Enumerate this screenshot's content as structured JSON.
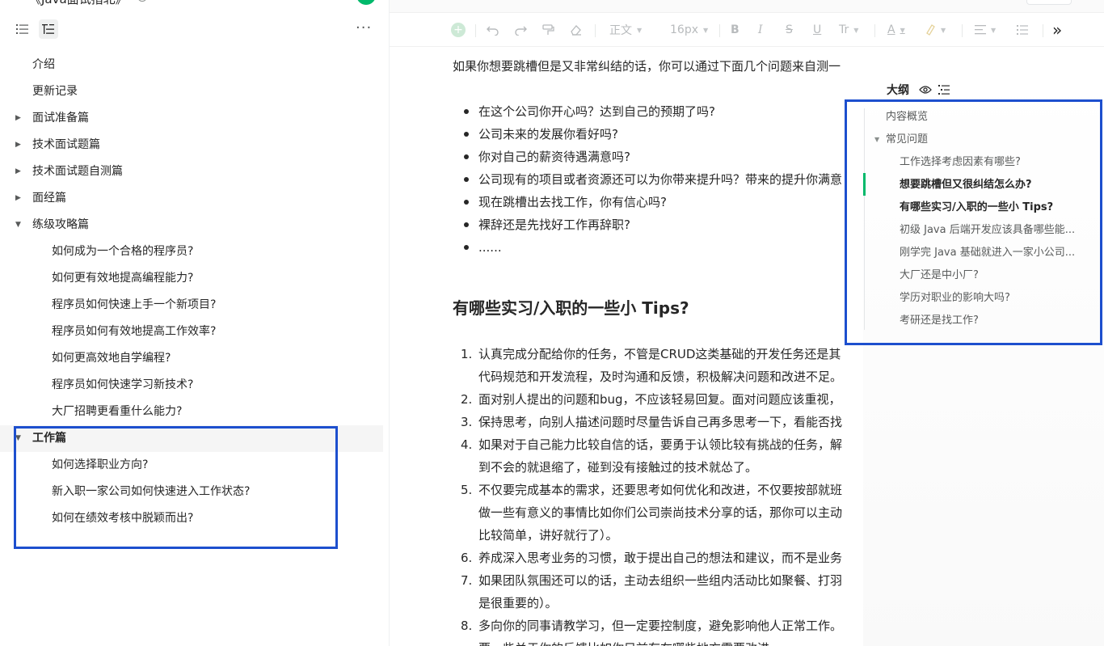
{
  "sidebar": {
    "title": "《Java面试指北》",
    "nav": [
      {
        "label": "介绍",
        "level": 0,
        "caret": ""
      },
      {
        "label": "更新记录",
        "level": 0,
        "caret": ""
      },
      {
        "label": "面试准备篇",
        "level": 0,
        "caret": "▶"
      },
      {
        "label": "技术面试题篇",
        "level": 0,
        "caret": "▶"
      },
      {
        "label": "技术面试题自测篇",
        "level": 0,
        "caret": "▶"
      },
      {
        "label": "面经篇",
        "level": 0,
        "caret": "▶"
      },
      {
        "label": "练级攻略篇",
        "level": 0,
        "caret": "▼"
      },
      {
        "label": "如何成为一个合格的程序员?",
        "level": 1,
        "caret": ""
      },
      {
        "label": "如何更有效地提高编程能力?",
        "level": 1,
        "caret": ""
      },
      {
        "label": "程序员如何快速上手一个新项目?",
        "level": 1,
        "caret": ""
      },
      {
        "label": "程序员如何有效地提高工作效率?",
        "level": 1,
        "caret": ""
      },
      {
        "label": "如何更高效地自学编程?",
        "level": 1,
        "caret": ""
      },
      {
        "label": "程序员如何快速学习新技术?",
        "level": 1,
        "caret": ""
      },
      {
        "label": "大厂招聘更看重什么能力?",
        "level": 1,
        "caret": ""
      },
      {
        "label": "工作篇",
        "level": 0,
        "caret": "▼",
        "selected": true
      },
      {
        "label": "如何选择职业方向?",
        "level": 1,
        "caret": ""
      },
      {
        "label": "新入职一家公司如何快速进入工作状态?",
        "level": 1,
        "caret": ""
      },
      {
        "label": "如何在绩效考核中脱颖而出?",
        "level": 1,
        "caret": ""
      }
    ],
    "more_label": "···",
    "highlight_color": "#1d4fce"
  },
  "toolbar": {
    "style_label": "正文",
    "size_label": "16px"
  },
  "doc": {
    "intro": "如果你想要跳槽但是又非常纠结的话，你可以通过下面几个问题来自测一",
    "bullets": [
      "在这个公司你开心吗？达到自己的预期了吗?",
      "公司未来的发展你看好吗?",
      "你对自己的薪资待遇满意吗?",
      "公司现有的项目或者资源还可以为你带来提升吗？带来的提升你满意",
      "现在跳槽出去找工作，你有信心吗?",
      "裸辞还是先找好工作再辞职?",
      "......"
    ],
    "heading": "有哪些实习/入职的一些小 Tips?",
    "numbered": [
      {
        "n": "1.",
        "lines": [
          "认真完成分配给你的任务，不管是CRUD这类基础的开发任务还是其",
          "代码规范和开发流程，及时沟通和反馈，积极解决问题和改进不足。"
        ]
      },
      {
        "n": "2.",
        "lines": [
          "面对别人提出的问题和bug，不应该轻易回复。面对问题应该重视，"
        ]
      },
      {
        "n": "3.",
        "lines": [
          "保持思考，向别人描述问题时尽量告诉自己再多思考一下，看能否找"
        ]
      },
      {
        "n": "4.",
        "lines": [
          "如果对于自己能力比较自信的话，要勇于认领比较有挑战的任务，解",
          "到不会的就退缩了，碰到没有接触过的技术就怂了。"
        ]
      },
      {
        "n": "5.",
        "lines": [
          "不仅要完成基本的需求，还要思考如何优化和改进，不仅要按部就班",
          "做一些有意义的事情比如你们公司崇尚技术分享的话，那你可以主动",
          "比较简单，讲好就行了）。"
        ]
      },
      {
        "n": "6.",
        "lines": [
          "养成深入思考业务的习惯，敢于提出自己的想法和建议，而不是业务"
        ]
      },
      {
        "n": "7.",
        "lines": [
          "如果团队氛围还可以的话，主动去组织一些组内活动比如聚餐、打羽",
          "是很重要的）。"
        ]
      },
      {
        "n": "8.",
        "lines": [
          "多向你的同事请教学习，但一定要控制度，避免影响他人正常工作。",
          "要一些关于你的反馈比如你目前存在哪些地方需要改进"
        ]
      }
    ]
  },
  "outline": {
    "title": "大纲",
    "items": [
      {
        "label": "内容概览",
        "level": 0,
        "bold": false,
        "caret": ""
      },
      {
        "label": "常见问题",
        "level": 0,
        "bold": false,
        "caret": "▼"
      },
      {
        "label": "工作选择考虑因素有哪些?",
        "level": 1,
        "bold": false,
        "caret": ""
      },
      {
        "label": "想要跳槽但又很纠结怎么办?",
        "level": 1,
        "bold": true,
        "caret": ""
      },
      {
        "label": "有哪些实习/入职的一些小 Tips?",
        "level": 1,
        "bold": true,
        "caret": ""
      },
      {
        "label": "初级 Java 后端开发应该具备哪些能...",
        "level": 1,
        "bold": false,
        "caret": ""
      },
      {
        "label": "刚学完 Java 基础就进入一家小公司...",
        "level": 1,
        "bold": false,
        "caret": ""
      },
      {
        "label": "大厂还是中小厂?",
        "level": 1,
        "bold": false,
        "caret": ""
      },
      {
        "label": "学历对职业的影响大吗?",
        "level": 1,
        "bold": false,
        "caret": ""
      },
      {
        "label": "考研还是找工作?",
        "level": 1,
        "bold": false,
        "caret": ""
      }
    ]
  },
  "colors": {
    "accent": "#00b96b",
    "annotation": "#1d4fce",
    "text": "#262626",
    "muted": "#585a5a"
  }
}
